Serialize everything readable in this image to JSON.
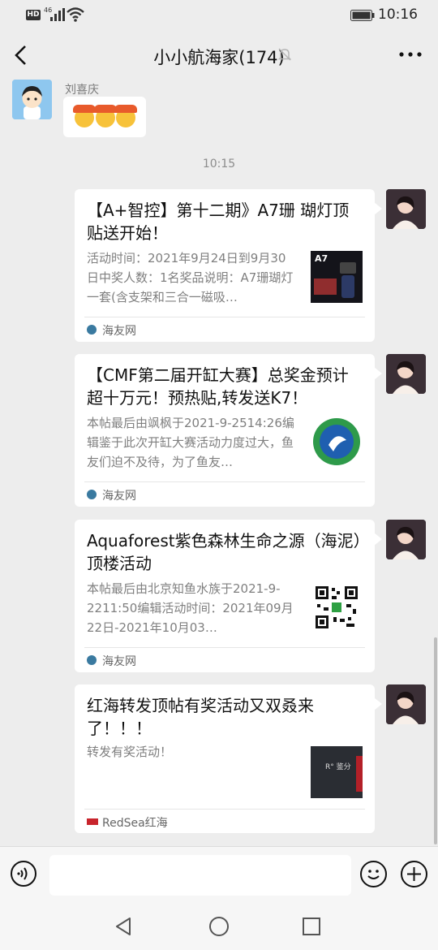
{
  "status_bar": {
    "hd": "HD",
    "network": "46",
    "time": "10:16"
  },
  "header": {
    "title": "小小航海家(174)"
  },
  "messages": {
    "sender_name": "刘喜庆",
    "timestamp": "10:15"
  },
  "cards": [
    {
      "title": "【A+智控】第十二期》A7珊 瑚灯顶贴送开始！",
      "desc": "活动时间：2021年9月24日到9月30日中奖人数：1名奖品说明：A7珊瑚灯一套(含支架和三合一磁吸…",
      "thumb_text": "A7",
      "source": "海友网"
    },
    {
      "title": "【CMF第二届开缸大赛】总奖金预计超十万元！预热贴,转发送K7！",
      "desc": "本帖最后由飒枫于2021-9-2514:26编辑鉴于此次开缸大赛活动力度过大，鱼友们迫不及待，为了鱼友…",
      "source": "海友网"
    },
    {
      "title": "Aquaforest紫色森林生命之源（海泥）顶楼活动",
      "desc": "本帖最后由北京知鱼水族于2021-9-2211:50编辑活动时间：2021年09月22日-2021年10月03…",
      "source": "海友网"
    },
    {
      "title": "红海转发顶帖有奖活动又双叒来了！！！",
      "desc": "转发有奖活动！",
      "thumb_text": "R° 鉴分",
      "source": "RedSea红海"
    }
  ],
  "colors": {
    "background": "#ededed",
    "bubble": "#ffffff",
    "secondary_text": "#7f7f7f"
  },
  "icons": [
    "back-arrow-icon",
    "mute-bell-icon",
    "more-dots-icon",
    "voice-icon",
    "emoji-icon",
    "plus-icon",
    "nav-back-icon",
    "nav-home-icon",
    "nav-recents-icon"
  ]
}
